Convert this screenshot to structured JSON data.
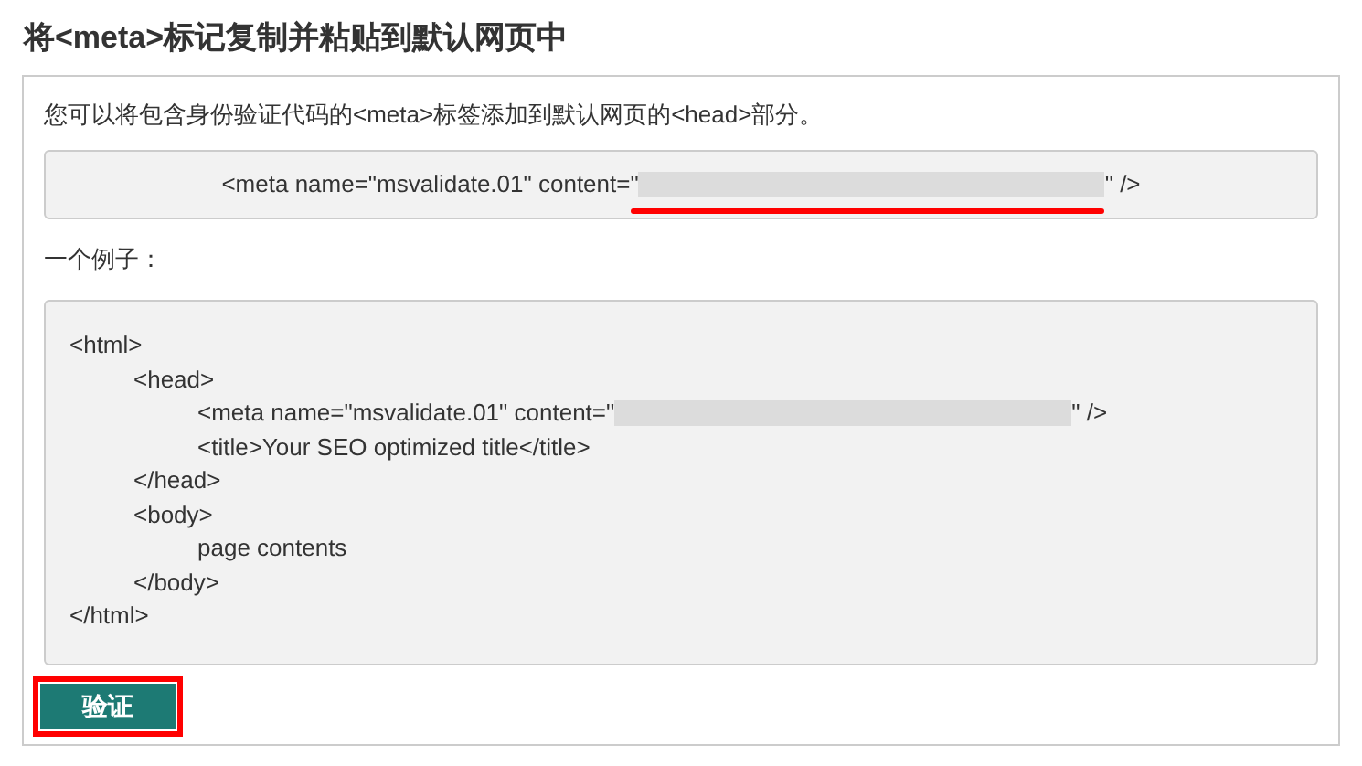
{
  "heading": "将<meta>标记复制并粘贴到默认网页中",
  "intro": "您可以将包含身份验证代码的<meta>标签添加到默认网页的<head>部分。",
  "meta_tag": {
    "prefix": "<meta name=\"msvalidate.01\" content=\"",
    "suffix": "\" />",
    "redacted": true,
    "underlined": true
  },
  "example_label": "一个例子：",
  "example_code": [
    {
      "kind": "element",
      "open": "<html>",
      "close": "</html>",
      "children": [
        {
          "kind": "element",
          "open": "<head>",
          "close": "</head>",
          "children": [
            {
              "kind": "meta",
              "prefix": "<meta name=\"msvalidate.01\" content=\"",
              "suffix": "\" />",
              "redacted": true
            },
            {
              "kind": "text",
              "text": "<title>Your SEO optimized title</title>"
            }
          ]
        },
        {
          "kind": "element",
          "open": "<body>",
          "close": "</body>",
          "children": [
            {
              "kind": "text",
              "text": "page contents"
            }
          ]
        }
      ]
    }
  ],
  "verify_button": {
    "label": "验证",
    "highlighted": true
  }
}
